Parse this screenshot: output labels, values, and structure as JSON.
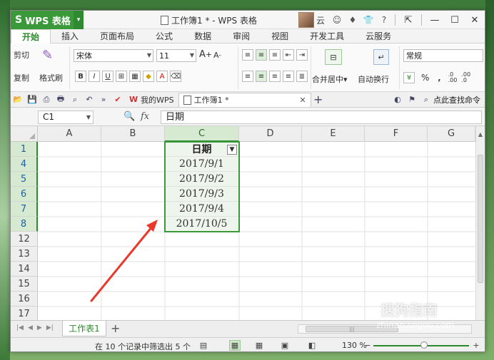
{
  "app": {
    "name": "WPS 表格",
    "window_title": "工作簿1 * - WPS 表格",
    "user": "云"
  },
  "tabs": [
    "开始",
    "插入",
    "页面布局",
    "公式",
    "数据",
    "审阅",
    "视图",
    "开发工具",
    "云服务"
  ],
  "ribbon": {
    "cut": "剪切",
    "copy": "复制",
    "format_painter": "格式刷",
    "font_name": "宋体",
    "font_size": "11",
    "merge_center": "合并居中",
    "wrap_text": "自动换行",
    "number_format": "常规",
    "percent": "%",
    "comma": ",",
    "dec_inc": ".0\n.00",
    "dec_dec": ".00\n.0",
    "bold": "B",
    "italic": "I",
    "underline": "U",
    "grow_font": "A",
    "shrink_font": "A"
  },
  "quick_access": {
    "my_wps": "我的WPS",
    "doc_tab": "工作簿1 *",
    "search": "点此查找命令"
  },
  "formula_bar": {
    "name_box": "C1",
    "fx": "fx",
    "content": "日期"
  },
  "columns": [
    "A",
    "B",
    "C",
    "D",
    "E",
    "F",
    "G"
  ],
  "rows": [
    "1",
    "4",
    "5",
    "6",
    "7",
    "8",
    "12",
    "13",
    "14",
    "15",
    "16",
    "17"
  ],
  "cells": {
    "c1": "日期",
    "dates": [
      "2017/9/1",
      "2017/9/2",
      "2017/9/3",
      "2017/9/4",
      "2017/10/5"
    ]
  },
  "sheet_tab": "工作表1",
  "status": {
    "message": "在 10 个记录中筛选出 5 个",
    "zoom": "130 %"
  },
  "watermark": {
    "brand": "搜狗指南",
    "url": "zhinan.sogou.com"
  },
  "colors": {
    "accent": "#3a9a3a",
    "arrow": "#e8392a"
  }
}
